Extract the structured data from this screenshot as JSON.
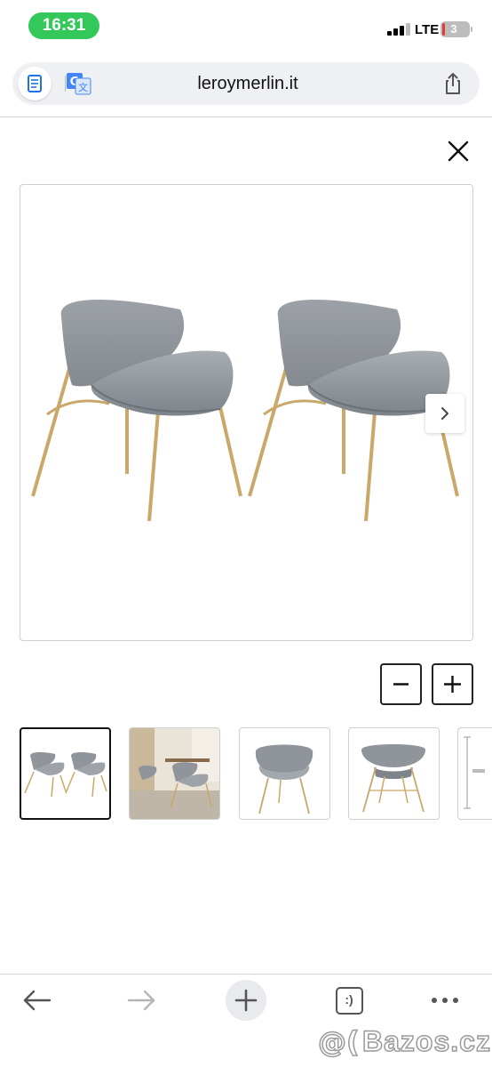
{
  "status_bar": {
    "time": "16:31",
    "network": "LTE",
    "battery": "3",
    "time_pill_color": "#34c759",
    "battery_level": 0.03
  },
  "address_bar": {
    "url": "leroymerlin.it",
    "reader_icon": "reader-icon",
    "translate_icon": "translate-icon",
    "share_icon": "share-icon"
  },
  "gallery": {
    "close_icon": "close-icon",
    "next_icon": "chevron-right-icon",
    "main_image": "two grey velvet armchairs with gold legs",
    "zoom_out_icon": "minus-icon",
    "zoom_in_icon": "plus-icon",
    "thumbnails": [
      {
        "description": "two grey chairs",
        "selected": true
      },
      {
        "description": "chairs in dining room",
        "selected": false
      },
      {
        "description": "chair front view",
        "selected": false
      },
      {
        "description": "chair back view",
        "selected": false
      },
      {
        "description": "dimension drawing",
        "selected": false
      }
    ]
  },
  "toolbar": {
    "back_icon": "arrow-left-icon",
    "forward_icon": "arrow-right-icon",
    "new_tab_icon": "plus-icon",
    "tabs_count": ":)",
    "more_icon": "more-icon"
  },
  "watermark": {
    "text": "Bazos.cz"
  }
}
